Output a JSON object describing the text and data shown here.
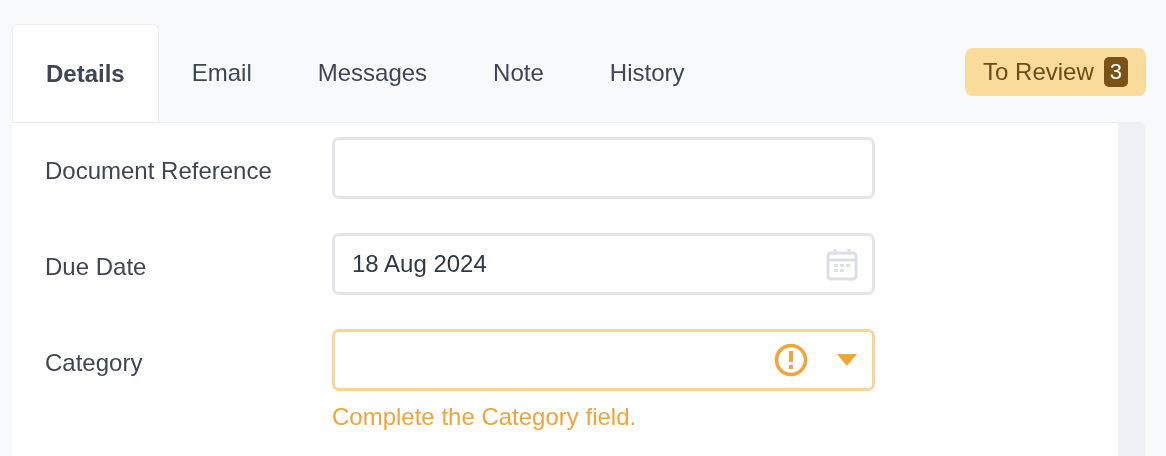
{
  "tabs": [
    {
      "label": "Details",
      "selected": true
    },
    {
      "label": "Email",
      "selected": false
    },
    {
      "label": "Messages",
      "selected": false
    },
    {
      "label": "Note",
      "selected": false
    },
    {
      "label": "History",
      "selected": false
    }
  ],
  "review_button": {
    "label": "To Review",
    "count": "3"
  },
  "fields": [
    {
      "kind": "text",
      "label": "Document Reference",
      "invalid": false
    },
    {
      "kind": "date",
      "label": "Due Date",
      "value": "18 Aug 2024",
      "invalid": false
    },
    {
      "kind": "select",
      "label": "Category",
      "invalid": true,
      "error": "Complete the Category field."
    }
  ]
}
